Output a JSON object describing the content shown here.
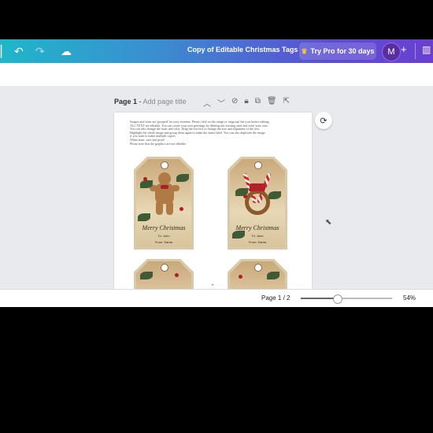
{
  "header": {
    "title": "Copy of Editable Christmas Tags",
    "pro_label": "Try Pro for 30 days",
    "pro_icon": "crown-icon",
    "avatar_initial": "M"
  },
  "page": {
    "label": "Page 1",
    "separator": " - ",
    "title_placeholder": "Add page title"
  },
  "instructions": [
    "Images and fonts are 'grouped' for easy moment. Please click on the image or 'ungroup' the icon before editing.",
    "ALL TEXT are editable. You can create your own greetings by deleting the existing ones and write your own.",
    "You can also change the fonts and color. Drag the text box to change the size and alignment of the text.",
    "Highlight the whole image and group them again to make the entire label. You can also duplicate the image",
    "if you want to make multiple copies.",
    "When done, save and print!",
    "Please note that the graphics are not editable."
  ],
  "tags": [
    {
      "greeting": "Merry Christmas",
      "to": "To: John",
      "from": "From: Santa"
    },
    {
      "greeting": "Merry Christmas",
      "to": "To: Jane",
      "from": "From: Santa"
    }
  ],
  "footer": {
    "page_count": "Page 1 / 2",
    "zoom": "54%",
    "zoom_value": 54
  }
}
